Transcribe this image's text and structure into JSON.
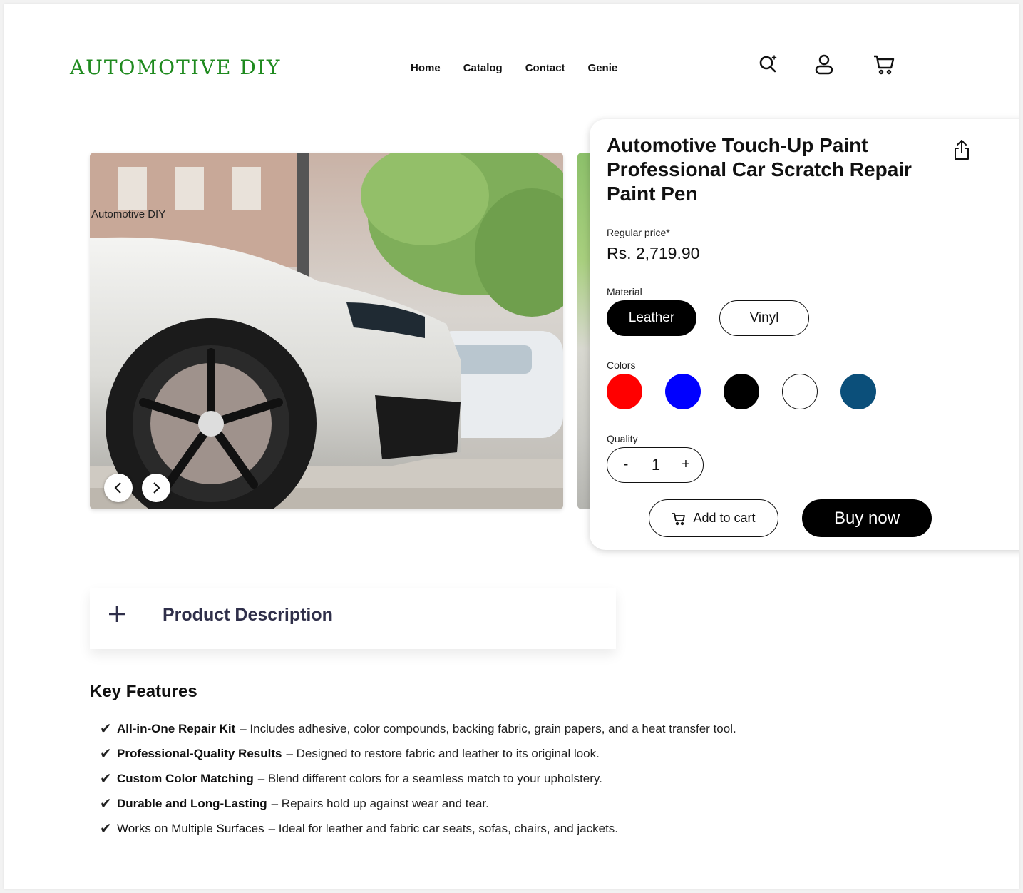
{
  "header": {
    "logo": "AUTOMOTIVE DIY",
    "nav": [
      "Home",
      "Catalog",
      "Contact",
      "Genie"
    ],
    "icons": [
      "search-sparkle-icon",
      "user-icon",
      "cart-icon"
    ]
  },
  "gallery": {
    "caption": "Automotive DIY",
    "prev_icon": "chevron-left-icon",
    "next_icon": "chevron-right-icon"
  },
  "product": {
    "title": "Automotive Touch-Up Paint Professional Car Scratch Repair Paint Pen",
    "share_icon": "share-icon",
    "price_label": "Regular price*",
    "price": "Rs. 2,719.90",
    "material_label": "Material",
    "materials": [
      {
        "label": "Leather",
        "selected": true
      },
      {
        "label": "Vinyl",
        "selected": false
      }
    ],
    "colors_label": "Colors",
    "colors": [
      "#ff0000",
      "#0000ff",
      "#000000",
      "#ffffff",
      "#0b4f7a"
    ],
    "quality_label": "Quality",
    "quantity": {
      "minus": "-",
      "value": "1",
      "plus": "+"
    },
    "add_to_cart": "Add to cart",
    "buy_now": "Buy now"
  },
  "description": {
    "toggle": "+",
    "title": "Product Description"
  },
  "key_features": {
    "title": "Key Features",
    "check": "✔",
    "items": [
      {
        "name": "All-in-One Repair Kit",
        "text": "– Includes adhesive, color compounds, backing fabric, grain papers, and a heat transfer tool.",
        "bold": true
      },
      {
        "name": "Professional-Quality Results",
        "text": "– Designed to restore fabric and leather to its original look.",
        "bold": true
      },
      {
        "name": "Custom Color Matching",
        "text": "– Blend different colors for a seamless match to your upholstery.",
        "bold": true
      },
      {
        "name": "Durable and Long-Lasting",
        "text": "– Repairs hold up against wear and tear.",
        "bold": true
      },
      {
        "name": "Works on Multiple Surfaces",
        "text": "– Ideal for leather and fabric car seats, sofas, chairs, and jackets.",
        "bold": false
      }
    ]
  }
}
